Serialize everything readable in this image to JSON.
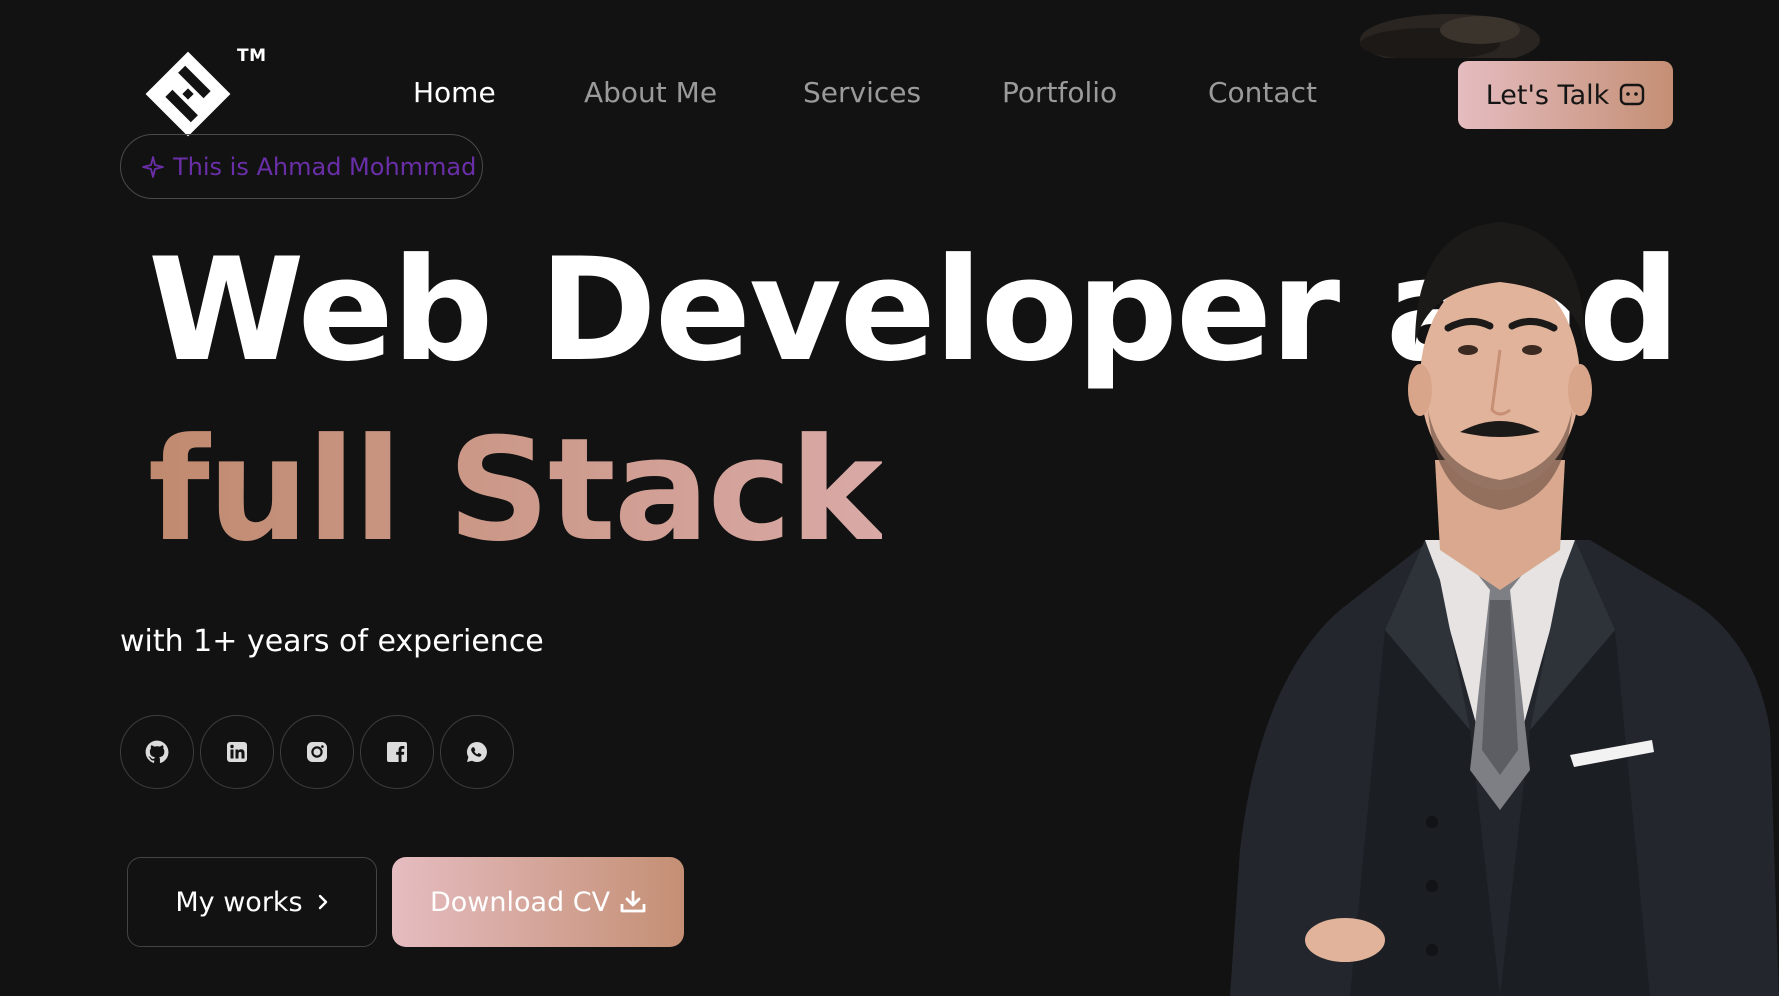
{
  "brand": {
    "tm": "TM"
  },
  "nav": {
    "items": [
      {
        "label": "Home",
        "active": true
      },
      {
        "label": "About Me",
        "active": false
      },
      {
        "label": "Services",
        "active": false
      },
      {
        "label": "Portfolio",
        "active": false
      },
      {
        "label": "Contact",
        "active": false
      }
    ]
  },
  "cta_header": {
    "label": "Let's Talk",
    "icon": "chat-icon"
  },
  "hero": {
    "intro": "This is Ahmad Mohmmad",
    "intro_icon": "sparkle-icon",
    "headline_line1": "Web Developer and",
    "headline_line2": "full Stack",
    "subtitle": "with 1+ years of experience"
  },
  "social": [
    {
      "name": "github-icon"
    },
    {
      "name": "linkedin-icon"
    },
    {
      "name": "instagram-icon"
    },
    {
      "name": "facebook-icon"
    },
    {
      "name": "whatsapp-icon"
    }
  ],
  "buttons": {
    "works": "My works",
    "works_icon": "chevron-right-icon",
    "cv": "Download CV",
    "cv_icon": "download-icon"
  },
  "colors": {
    "background": "#121212",
    "accent_start": "#e5bcc0",
    "accent_end": "#c48f74",
    "intro_text": "#6a2fa8",
    "nav_inactive": "#9a9a9a"
  }
}
